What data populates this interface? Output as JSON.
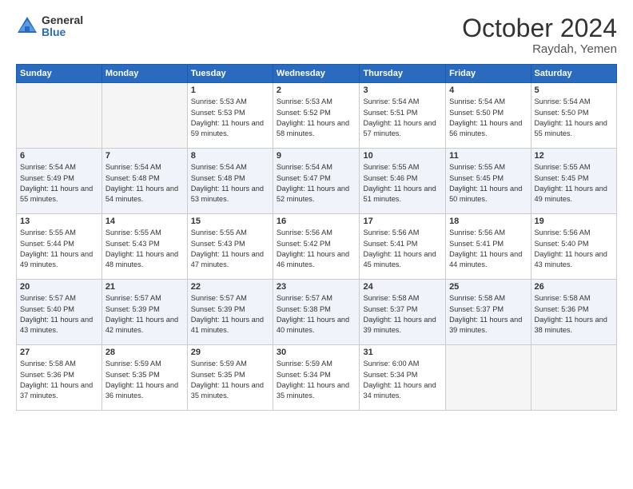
{
  "header": {
    "logo_general": "General",
    "logo_blue": "Blue",
    "month_title": "October 2024",
    "location": "Raydah, Yemen"
  },
  "days_of_week": [
    "Sunday",
    "Monday",
    "Tuesday",
    "Wednesday",
    "Thursday",
    "Friday",
    "Saturday"
  ],
  "weeks": [
    [
      {
        "day": "",
        "sunrise": "",
        "sunset": "",
        "daylight": ""
      },
      {
        "day": "",
        "sunrise": "",
        "sunset": "",
        "daylight": ""
      },
      {
        "day": "1",
        "sunrise": "Sunrise: 5:53 AM",
        "sunset": "Sunset: 5:53 PM",
        "daylight": "Daylight: 11 hours and 59 minutes."
      },
      {
        "day": "2",
        "sunrise": "Sunrise: 5:53 AM",
        "sunset": "Sunset: 5:52 PM",
        "daylight": "Daylight: 11 hours and 58 minutes."
      },
      {
        "day": "3",
        "sunrise": "Sunrise: 5:54 AM",
        "sunset": "Sunset: 5:51 PM",
        "daylight": "Daylight: 11 hours and 57 minutes."
      },
      {
        "day": "4",
        "sunrise": "Sunrise: 5:54 AM",
        "sunset": "Sunset: 5:50 PM",
        "daylight": "Daylight: 11 hours and 56 minutes."
      },
      {
        "day": "5",
        "sunrise": "Sunrise: 5:54 AM",
        "sunset": "Sunset: 5:50 PM",
        "daylight": "Daylight: 11 hours and 55 minutes."
      }
    ],
    [
      {
        "day": "6",
        "sunrise": "Sunrise: 5:54 AM",
        "sunset": "Sunset: 5:49 PM",
        "daylight": "Daylight: 11 hours and 55 minutes."
      },
      {
        "day": "7",
        "sunrise": "Sunrise: 5:54 AM",
        "sunset": "Sunset: 5:48 PM",
        "daylight": "Daylight: 11 hours and 54 minutes."
      },
      {
        "day": "8",
        "sunrise": "Sunrise: 5:54 AM",
        "sunset": "Sunset: 5:48 PM",
        "daylight": "Daylight: 11 hours and 53 minutes."
      },
      {
        "day": "9",
        "sunrise": "Sunrise: 5:54 AM",
        "sunset": "Sunset: 5:47 PM",
        "daylight": "Daylight: 11 hours and 52 minutes."
      },
      {
        "day": "10",
        "sunrise": "Sunrise: 5:55 AM",
        "sunset": "Sunset: 5:46 PM",
        "daylight": "Daylight: 11 hours and 51 minutes."
      },
      {
        "day": "11",
        "sunrise": "Sunrise: 5:55 AM",
        "sunset": "Sunset: 5:45 PM",
        "daylight": "Daylight: 11 hours and 50 minutes."
      },
      {
        "day": "12",
        "sunrise": "Sunrise: 5:55 AM",
        "sunset": "Sunset: 5:45 PM",
        "daylight": "Daylight: 11 hours and 49 minutes."
      }
    ],
    [
      {
        "day": "13",
        "sunrise": "Sunrise: 5:55 AM",
        "sunset": "Sunset: 5:44 PM",
        "daylight": "Daylight: 11 hours and 49 minutes."
      },
      {
        "day": "14",
        "sunrise": "Sunrise: 5:55 AM",
        "sunset": "Sunset: 5:43 PM",
        "daylight": "Daylight: 11 hours and 48 minutes."
      },
      {
        "day": "15",
        "sunrise": "Sunrise: 5:55 AM",
        "sunset": "Sunset: 5:43 PM",
        "daylight": "Daylight: 11 hours and 47 minutes."
      },
      {
        "day": "16",
        "sunrise": "Sunrise: 5:56 AM",
        "sunset": "Sunset: 5:42 PM",
        "daylight": "Daylight: 11 hours and 46 minutes."
      },
      {
        "day": "17",
        "sunrise": "Sunrise: 5:56 AM",
        "sunset": "Sunset: 5:41 PM",
        "daylight": "Daylight: 11 hours and 45 minutes."
      },
      {
        "day": "18",
        "sunrise": "Sunrise: 5:56 AM",
        "sunset": "Sunset: 5:41 PM",
        "daylight": "Daylight: 11 hours and 44 minutes."
      },
      {
        "day": "19",
        "sunrise": "Sunrise: 5:56 AM",
        "sunset": "Sunset: 5:40 PM",
        "daylight": "Daylight: 11 hours and 43 minutes."
      }
    ],
    [
      {
        "day": "20",
        "sunrise": "Sunrise: 5:57 AM",
        "sunset": "Sunset: 5:40 PM",
        "daylight": "Daylight: 11 hours and 43 minutes."
      },
      {
        "day": "21",
        "sunrise": "Sunrise: 5:57 AM",
        "sunset": "Sunset: 5:39 PM",
        "daylight": "Daylight: 11 hours and 42 minutes."
      },
      {
        "day": "22",
        "sunrise": "Sunrise: 5:57 AM",
        "sunset": "Sunset: 5:39 PM",
        "daylight": "Daylight: 11 hours and 41 minutes."
      },
      {
        "day": "23",
        "sunrise": "Sunrise: 5:57 AM",
        "sunset": "Sunset: 5:38 PM",
        "daylight": "Daylight: 11 hours and 40 minutes."
      },
      {
        "day": "24",
        "sunrise": "Sunrise: 5:58 AM",
        "sunset": "Sunset: 5:37 PM",
        "daylight": "Daylight: 11 hours and 39 minutes."
      },
      {
        "day": "25",
        "sunrise": "Sunrise: 5:58 AM",
        "sunset": "Sunset: 5:37 PM",
        "daylight": "Daylight: 11 hours and 39 minutes."
      },
      {
        "day": "26",
        "sunrise": "Sunrise: 5:58 AM",
        "sunset": "Sunset: 5:36 PM",
        "daylight": "Daylight: 11 hours and 38 minutes."
      }
    ],
    [
      {
        "day": "27",
        "sunrise": "Sunrise: 5:58 AM",
        "sunset": "Sunset: 5:36 PM",
        "daylight": "Daylight: 11 hours and 37 minutes."
      },
      {
        "day": "28",
        "sunrise": "Sunrise: 5:59 AM",
        "sunset": "Sunset: 5:35 PM",
        "daylight": "Daylight: 11 hours and 36 minutes."
      },
      {
        "day": "29",
        "sunrise": "Sunrise: 5:59 AM",
        "sunset": "Sunset: 5:35 PM",
        "daylight": "Daylight: 11 hours and 35 minutes."
      },
      {
        "day": "30",
        "sunrise": "Sunrise: 5:59 AM",
        "sunset": "Sunset: 5:34 PM",
        "daylight": "Daylight: 11 hours and 35 minutes."
      },
      {
        "day": "31",
        "sunrise": "Sunrise: 6:00 AM",
        "sunset": "Sunset: 5:34 PM",
        "daylight": "Daylight: 11 hours and 34 minutes."
      },
      {
        "day": "",
        "sunrise": "",
        "sunset": "",
        "daylight": ""
      },
      {
        "day": "",
        "sunrise": "",
        "sunset": "",
        "daylight": ""
      }
    ]
  ]
}
